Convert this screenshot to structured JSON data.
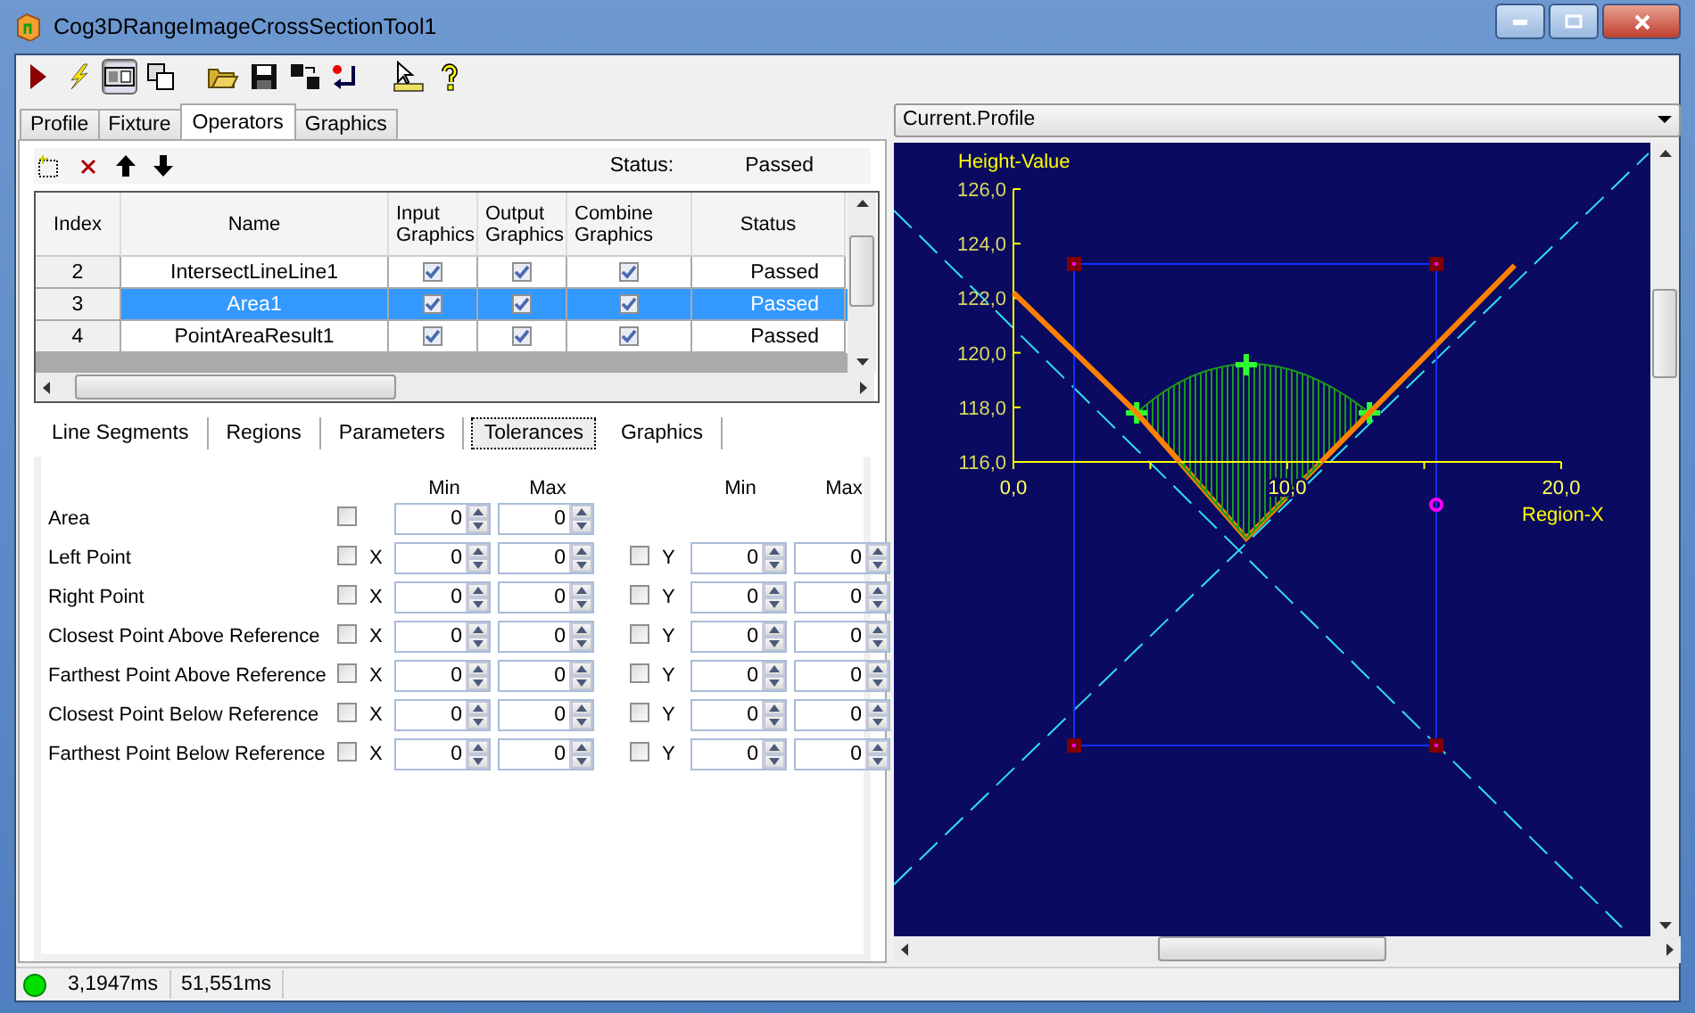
{
  "window": {
    "title": "Cog3DRangeImageCrossSectionTool1"
  },
  "toolbar_buttons": [
    {
      "kind": "run",
      "pressed": false
    },
    {
      "kind": "lightning",
      "pressed": false
    },
    {
      "kind": "panel",
      "pressed": true
    },
    {
      "kind": "windows",
      "pressed": false
    },
    {
      "kind": "open",
      "pressed": false
    },
    {
      "kind": "save",
      "pressed": false
    },
    {
      "kind": "transfer",
      "pressed": false
    },
    {
      "kind": "reset",
      "pressed": false
    },
    {
      "kind": "pointer",
      "pressed": false
    },
    {
      "kind": "help",
      "pressed": false
    }
  ],
  "tabs": [
    {
      "label": "Profile",
      "selected": false
    },
    {
      "label": "Fixture",
      "selected": false
    },
    {
      "label": "Operators",
      "selected": true
    },
    {
      "label": "Graphics",
      "selected": false
    }
  ],
  "operators": {
    "status_label": "Status:",
    "status": "Passed",
    "columns": [
      "Index",
      "Name",
      "Input Graphics",
      "Output Graphics",
      "Combine Graphics",
      "Status"
    ],
    "rows": [
      {
        "index": "2",
        "name": "IntersectLineLine1",
        "input_graphics": true,
        "output_graphics": true,
        "combine_graphics": true,
        "status": "Passed",
        "selected": false
      },
      {
        "index": "3",
        "name": "Area1",
        "input_graphics": true,
        "output_graphics": true,
        "combine_graphics": true,
        "status": "Passed",
        "selected": true
      },
      {
        "index": "4",
        "name": "PointAreaResult1",
        "input_graphics": true,
        "output_graphics": true,
        "combine_graphics": true,
        "status": "Passed",
        "selected": false
      }
    ]
  },
  "sub_tabs": [
    {
      "label": "Line Segments",
      "selected": false
    },
    {
      "label": "Regions",
      "selected": false
    },
    {
      "label": "Parameters",
      "selected": false
    },
    {
      "label": "Tolerances",
      "selected": true
    },
    {
      "label": "Graphics",
      "selected": false
    }
  ],
  "tolerances": {
    "headers": [
      "Min",
      "Max",
      "Min",
      "Max"
    ],
    "rows": [
      {
        "kind": "single",
        "label": "Area",
        "enabled": false,
        "min": "0",
        "max": "0"
      },
      {
        "kind": "xy",
        "label": "Left Point",
        "x_enabled": false,
        "x_label": "X",
        "x_min": "0",
        "x_max": "0",
        "y_enabled": false,
        "y_label": "Y",
        "y_min": "0",
        "y_max": "0"
      },
      {
        "kind": "xy",
        "label": "Right Point",
        "x_enabled": false,
        "x_label": "X",
        "x_min": "0",
        "x_max": "0",
        "y_enabled": false,
        "y_label": "Y",
        "y_min": "0",
        "y_max": "0"
      },
      {
        "kind": "xy",
        "label": "Closest Point Above Reference",
        "x_enabled": false,
        "x_label": "X",
        "x_min": "0",
        "x_max": "0",
        "y_enabled": false,
        "y_label": "Y",
        "y_min": "0",
        "y_max": "0"
      },
      {
        "kind": "xy",
        "label": "Farthest Point Above Reference",
        "x_enabled": false,
        "x_label": "X",
        "x_min": "0",
        "x_max": "0",
        "y_enabled": false,
        "y_label": "Y",
        "y_min": "0",
        "y_max": "0"
      },
      {
        "kind": "xy",
        "label": "Closest Point Below Reference",
        "x_enabled": false,
        "x_label": "X",
        "x_min": "0",
        "x_max": "0",
        "y_enabled": false,
        "y_label": "Y",
        "y_min": "0",
        "y_max": "0"
      },
      {
        "kind": "xy",
        "label": "Farthest Point Below Reference",
        "x_enabled": false,
        "x_label": "X",
        "x_min": "0",
        "x_max": "0",
        "y_enabled": false,
        "y_label": "Y",
        "y_min": "0",
        "y_max": "0"
      }
    ]
  },
  "display": {
    "selector": "Current.Profile",
    "chart_data": {
      "type": "line",
      "xlabel": "Region-X",
      "ylabel": "Height-Value",
      "x": [
        0,
        4.5,
        6.07,
        8.5,
        11.24,
        13,
        18.3
      ],
      "series": [
        {
          "color": "#ff8000",
          "values": [
            122.2,
            117.8,
            116,
            null,
            116,
            117.8,
            123.2
          ]
        }
      ],
      "xlim": [
        0,
        20
      ],
      "ylim": [
        116,
        126
      ],
      "xticks": [
        {
          "value": 0,
          "label": "0,0"
        },
        {
          "value": 10,
          "label": "10,0"
        },
        {
          "value": 20,
          "label": "20,0"
        }
      ],
      "yticks": [
        {
          "value": 116,
          "label": "116,0"
        },
        {
          "value": 118,
          "label": "118,0"
        },
        {
          "value": 120,
          "label": "120,0"
        },
        {
          "value": 122,
          "label": "122,0"
        },
        {
          "value": 124,
          "label": "124,0"
        },
        {
          "value": 126,
          "label": "126,0"
        }
      ]
    }
  },
  "status_bar": {
    "ok": true,
    "times": [
      "3,1947ms",
      "51,551ms"
    ]
  }
}
